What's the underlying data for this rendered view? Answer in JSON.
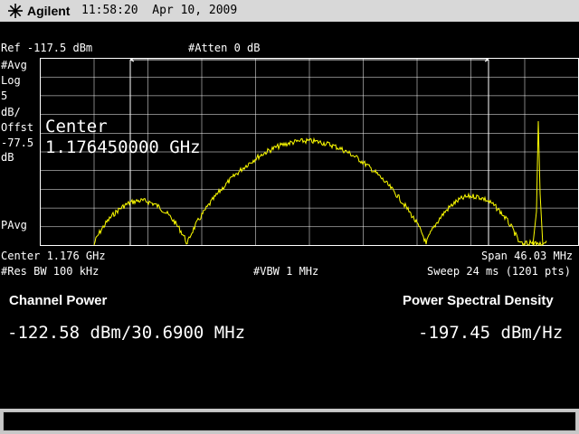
{
  "titlebar": {
    "brand": "Agilent",
    "time": "11:58:20",
    "date": "Apr 10, 2009"
  },
  "header": {
    "ref": "Ref -117.5 dBm",
    "atten": "#Atten 0 dB"
  },
  "left_panel": {
    "avg": "#Avg",
    "log": "Log",
    "scale_num": "5",
    "scale_unit": "dB/",
    "offst": "Offst",
    "offst_val": "-77.5",
    "offst_unit": "dB",
    "pavg": "PAvg"
  },
  "marker": {
    "line1": "Center",
    "line2": "1.176450000 GHz"
  },
  "bottom": {
    "center": "Center 1.176 GHz",
    "span": "Span 46.03 MHz",
    "res_bw": "#Res BW 100 kHz",
    "vbw": "#VBW 1 MHz",
    "sweep": "Sweep 24 ms (1201 pts)"
  },
  "results": {
    "channel_power_label": "Channel Power",
    "channel_power_value": "-122.58 dBm/30.6900 MHz",
    "psd_label": "Power Spectral Density",
    "psd_value": "-197.45 dBm/Hz"
  },
  "colors": {
    "trace": "#ffff00",
    "grid": "#ffffff",
    "background": "#000000"
  }
}
